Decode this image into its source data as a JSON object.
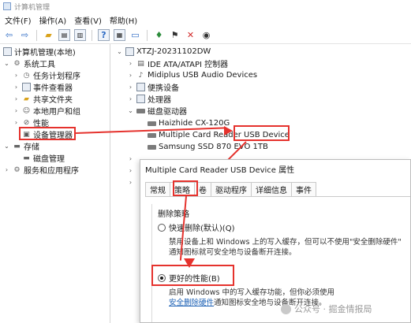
{
  "window": {
    "title": "计算机管理"
  },
  "menu": [
    "文件(F)",
    "操作(A)",
    "查看(V)",
    "帮助(H)"
  ],
  "toolbar": [
    "back-arrow-icon",
    "forward-arrow-icon",
    "up-folder-icon",
    "tree-view-icon",
    "properties-icon",
    "help-icon",
    "console-icon",
    "monitor-icon",
    "plug-icon",
    "disable-icon",
    "uninstall-icon",
    "download-icon"
  ],
  "left_tree": {
    "root": "计算机管理(本地)",
    "system_tools": "系统工具",
    "task_scheduler": "任务计划程序",
    "event_viewer": "事件查看器",
    "shared_folders": "共享文件夹",
    "local_users": "本地用户和组",
    "performance": "性能",
    "device_manager": "设备管理器",
    "storage": "存储",
    "disk_management": "磁盘管理",
    "services": "服务和应用程序"
  },
  "device_tree": {
    "computer": "XTZJ-20231102DW",
    "ide": "IDE ATA/ATAPI 控制器",
    "midiplus": "Midiplus USB Audio Devices",
    "portable": "便携设备",
    "processor": "处理器",
    "disk_drives": "磁盘驱动器",
    "haizhide": "Haizhide CX-120G",
    "multiple_card": "Multiple Card Reader USB Device",
    "samsung": "Samsung SSD 870 EVO 1TB"
  },
  "dialog": {
    "title": "Multiple Card Reader USB Device 属性",
    "tabs": [
      "常规",
      "策略",
      "卷",
      "驱动程序",
      "详细信息",
      "事件"
    ],
    "group": "删除策略",
    "quick_remove": "快速删除(默认)(Q)",
    "quick_desc_1": "禁用设备上和 Windows 上的写入缓存，但可以不使用\"安全删除硬件\"",
    "quick_desc_2": "通知图标就可安全地与设备断开连接。",
    "better_perf": "更好的性能(B)",
    "better_desc_1": "启用 Windows 中的写入缓存功能，但你必须使用",
    "better_desc_link": "安全删除硬件",
    "better_desc_2": "通知图标安全地与设备断开连接。"
  },
  "watermark": "公众号 · 掘金情报局",
  "colors": {
    "annotation": "#e5322d",
    "link": "#1a5fb4"
  }
}
